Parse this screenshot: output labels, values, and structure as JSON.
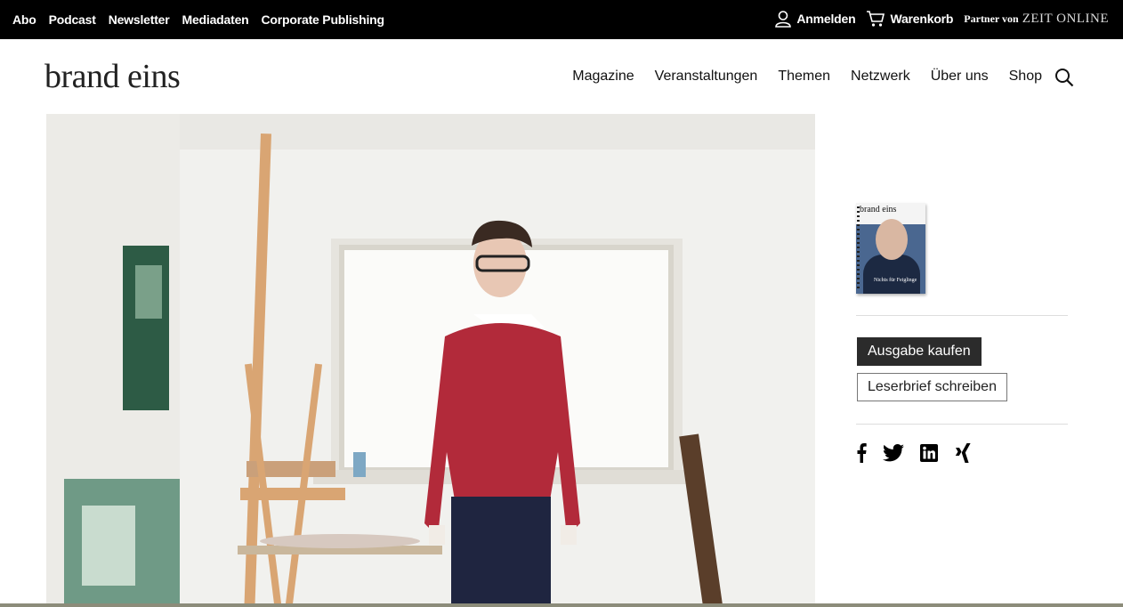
{
  "topbar": {
    "links": [
      "Abo",
      "Podcast",
      "Newsletter",
      "Mediadaten",
      "Corporate Publishing"
    ],
    "login": "Anmelden",
    "cart": "Warenkorb",
    "partner_prefix": "Partner von",
    "partner_name": "ZEIT ONLINE"
  },
  "header": {
    "logo": "brand eins",
    "nav": [
      "Magazine",
      "Veranstaltungen",
      "Themen",
      "Netzwerk",
      "Über uns",
      "Shop"
    ]
  },
  "sidebar": {
    "cover_brand": "brand eins",
    "cover_title": "Nichts für Feiglinge",
    "buy_button": "Ausgabe kaufen",
    "letter_button": "Leserbrief schreiben"
  },
  "colors": {
    "topbar": "#000000",
    "button_dark": "#2b2b2b",
    "sweater": "#b22a3a"
  },
  "icons": [
    "user-icon",
    "cart-icon",
    "search-icon",
    "facebook-icon",
    "twitter-icon",
    "linkedin-icon",
    "xing-icon"
  ]
}
